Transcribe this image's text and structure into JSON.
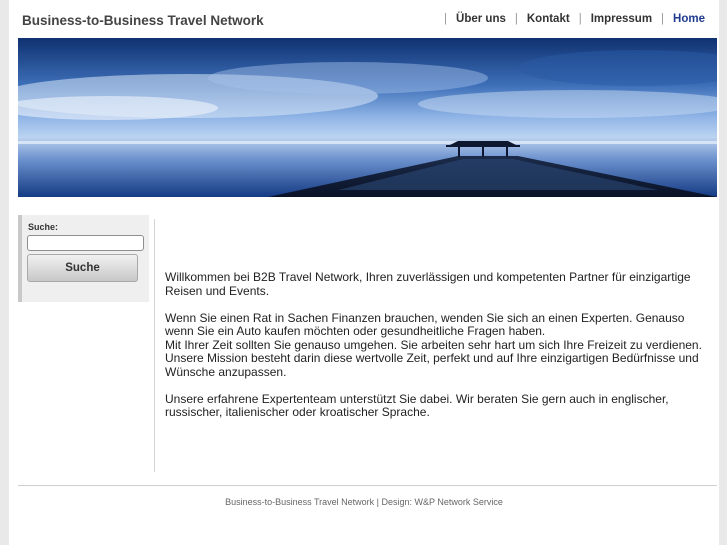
{
  "header": {
    "title": "Business-to-Business Travel Network",
    "nav": [
      {
        "label": "Über uns",
        "active": false
      },
      {
        "label": "Kontakt",
        "active": false
      },
      {
        "label": "Impressum",
        "active": false
      },
      {
        "label": "Home",
        "active": true
      }
    ],
    "separator": "|"
  },
  "sidebar": {
    "search_label": "Suche:",
    "search_value": "",
    "search_button": "Suche"
  },
  "main": {
    "paragraphs": [
      "Willkommen bei B2B Travel Network, Ihren zuverlässigen und kompetenten Partner für einzigartige Reisen und Events.",
      "Wenn Sie einen Rat in Sachen Finanzen brauchen, wenden Sie sich an einen Experten. Genauso wenn Sie ein Auto kaufen möchten oder gesundheitliche Fragen haben.",
      "Mit Ihrer Zeit sollten Sie genauso umgehen. Sie arbeiten sehr hart um sich Ihre Freizeit zu verdienen. Unsere Mission besteht darin diese wertvolle Zeit, perfekt und auf Ihre einzigartigen Bedürfnisse und Wünsche anzupassen.",
      "Unsere erfahrene Expertenteam unterstützt Sie dabei. Wir beraten Sie gern auch in englischer, russischer, italienischer oder kroatischer Sprache."
    ]
  },
  "footer": {
    "text": "Business-to-Business Travel Network | Design: W&P Network Service"
  },
  "colors": {
    "active_nav": "#1f3a8f",
    "page_bg": "#e9e9e9",
    "sky_top": "#123a7a",
    "sky_mid": "#5b8fd1"
  }
}
